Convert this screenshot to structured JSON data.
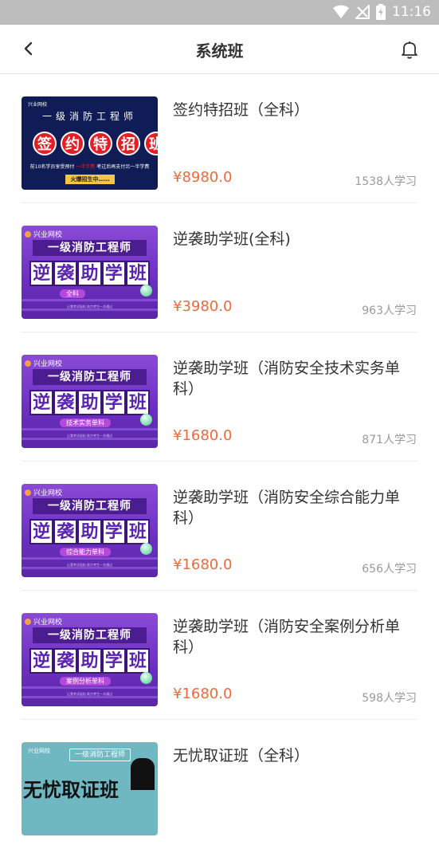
{
  "status_bar": {
    "time": "11:16",
    "icons": [
      "wifi-icon",
      "no-signal-icon",
      "battery-charging-icon"
    ]
  },
  "header": {
    "title": "系统班",
    "icons": [
      "back-arrow-icon",
      "bell-icon"
    ]
  },
  "colors": {
    "price": "#ef6a3b",
    "status_bar": "#bdbdbd",
    "divider": "#ececec"
  },
  "courses": [
    {
      "title": "签约特招班（全科）",
      "price": "¥8980.0",
      "learners": "1538人学习",
      "thumbnail": {
        "style": "navy",
        "school": "兴业网校",
        "subtitle": "一级消防工程师",
        "chars": [
          "签",
          "约",
          "特",
          "招",
          "班"
        ],
        "line_a": "前10名学员享受预付 ",
        "line_red": "一半学费",
        "line_b": " 考过后再支付另一半学费",
        "tag": "火爆招生中……"
      }
    },
    {
      "title": "逆袭助学班(全科)",
      "price": "¥3980.0",
      "learners": "963人学习",
      "thumbnail": {
        "style": "purple",
        "school": "兴业网校",
        "subtitle": "一级消防工程师",
        "chars": [
          "逆",
          "袭",
          "助",
          "学",
          "班"
        ],
        "pill": "全科",
        "footer": "让我考试轻松 助力考生一次通过"
      }
    },
    {
      "title": "逆袭助学班（消防安全技术实务单科）",
      "price": "¥1680.0",
      "learners": "871人学习",
      "thumbnail": {
        "style": "purple",
        "school": "兴业网校",
        "subtitle": "一级消防工程师",
        "chars": [
          "逆",
          "袭",
          "助",
          "学",
          "班"
        ],
        "pill": "技术实务单科",
        "footer": "让我考试轻松 助力考生一次通过"
      }
    },
    {
      "title": "逆袭助学班（消防安全综合能力单科）",
      "price": "¥1680.0",
      "learners": "656人学习",
      "thumbnail": {
        "style": "purple",
        "school": "兴业网校",
        "subtitle": "一级消防工程师",
        "chars": [
          "逆",
          "袭",
          "助",
          "学",
          "班"
        ],
        "pill": "综合能力单科",
        "footer": "让我考试轻松 助力考生一次通过"
      }
    },
    {
      "title": "逆袭助学班（消防安全案例分析单科）",
      "price": "¥1680.0",
      "learners": "598人学习",
      "thumbnail": {
        "style": "purple",
        "school": "兴业网校",
        "subtitle": "一级消防工程师",
        "chars": [
          "逆",
          "袭",
          "助",
          "学",
          "班"
        ],
        "pill": "案例分析单科",
        "footer": "让我考试轻松 助力考生一次通过"
      }
    },
    {
      "title": "无忧取证班（全科）",
      "price": "",
      "learners": "",
      "thumbnail": {
        "style": "teal",
        "school": "兴业网校",
        "subtitle": "一级消防工程师",
        "big": "无忧取证班"
      }
    }
  ]
}
